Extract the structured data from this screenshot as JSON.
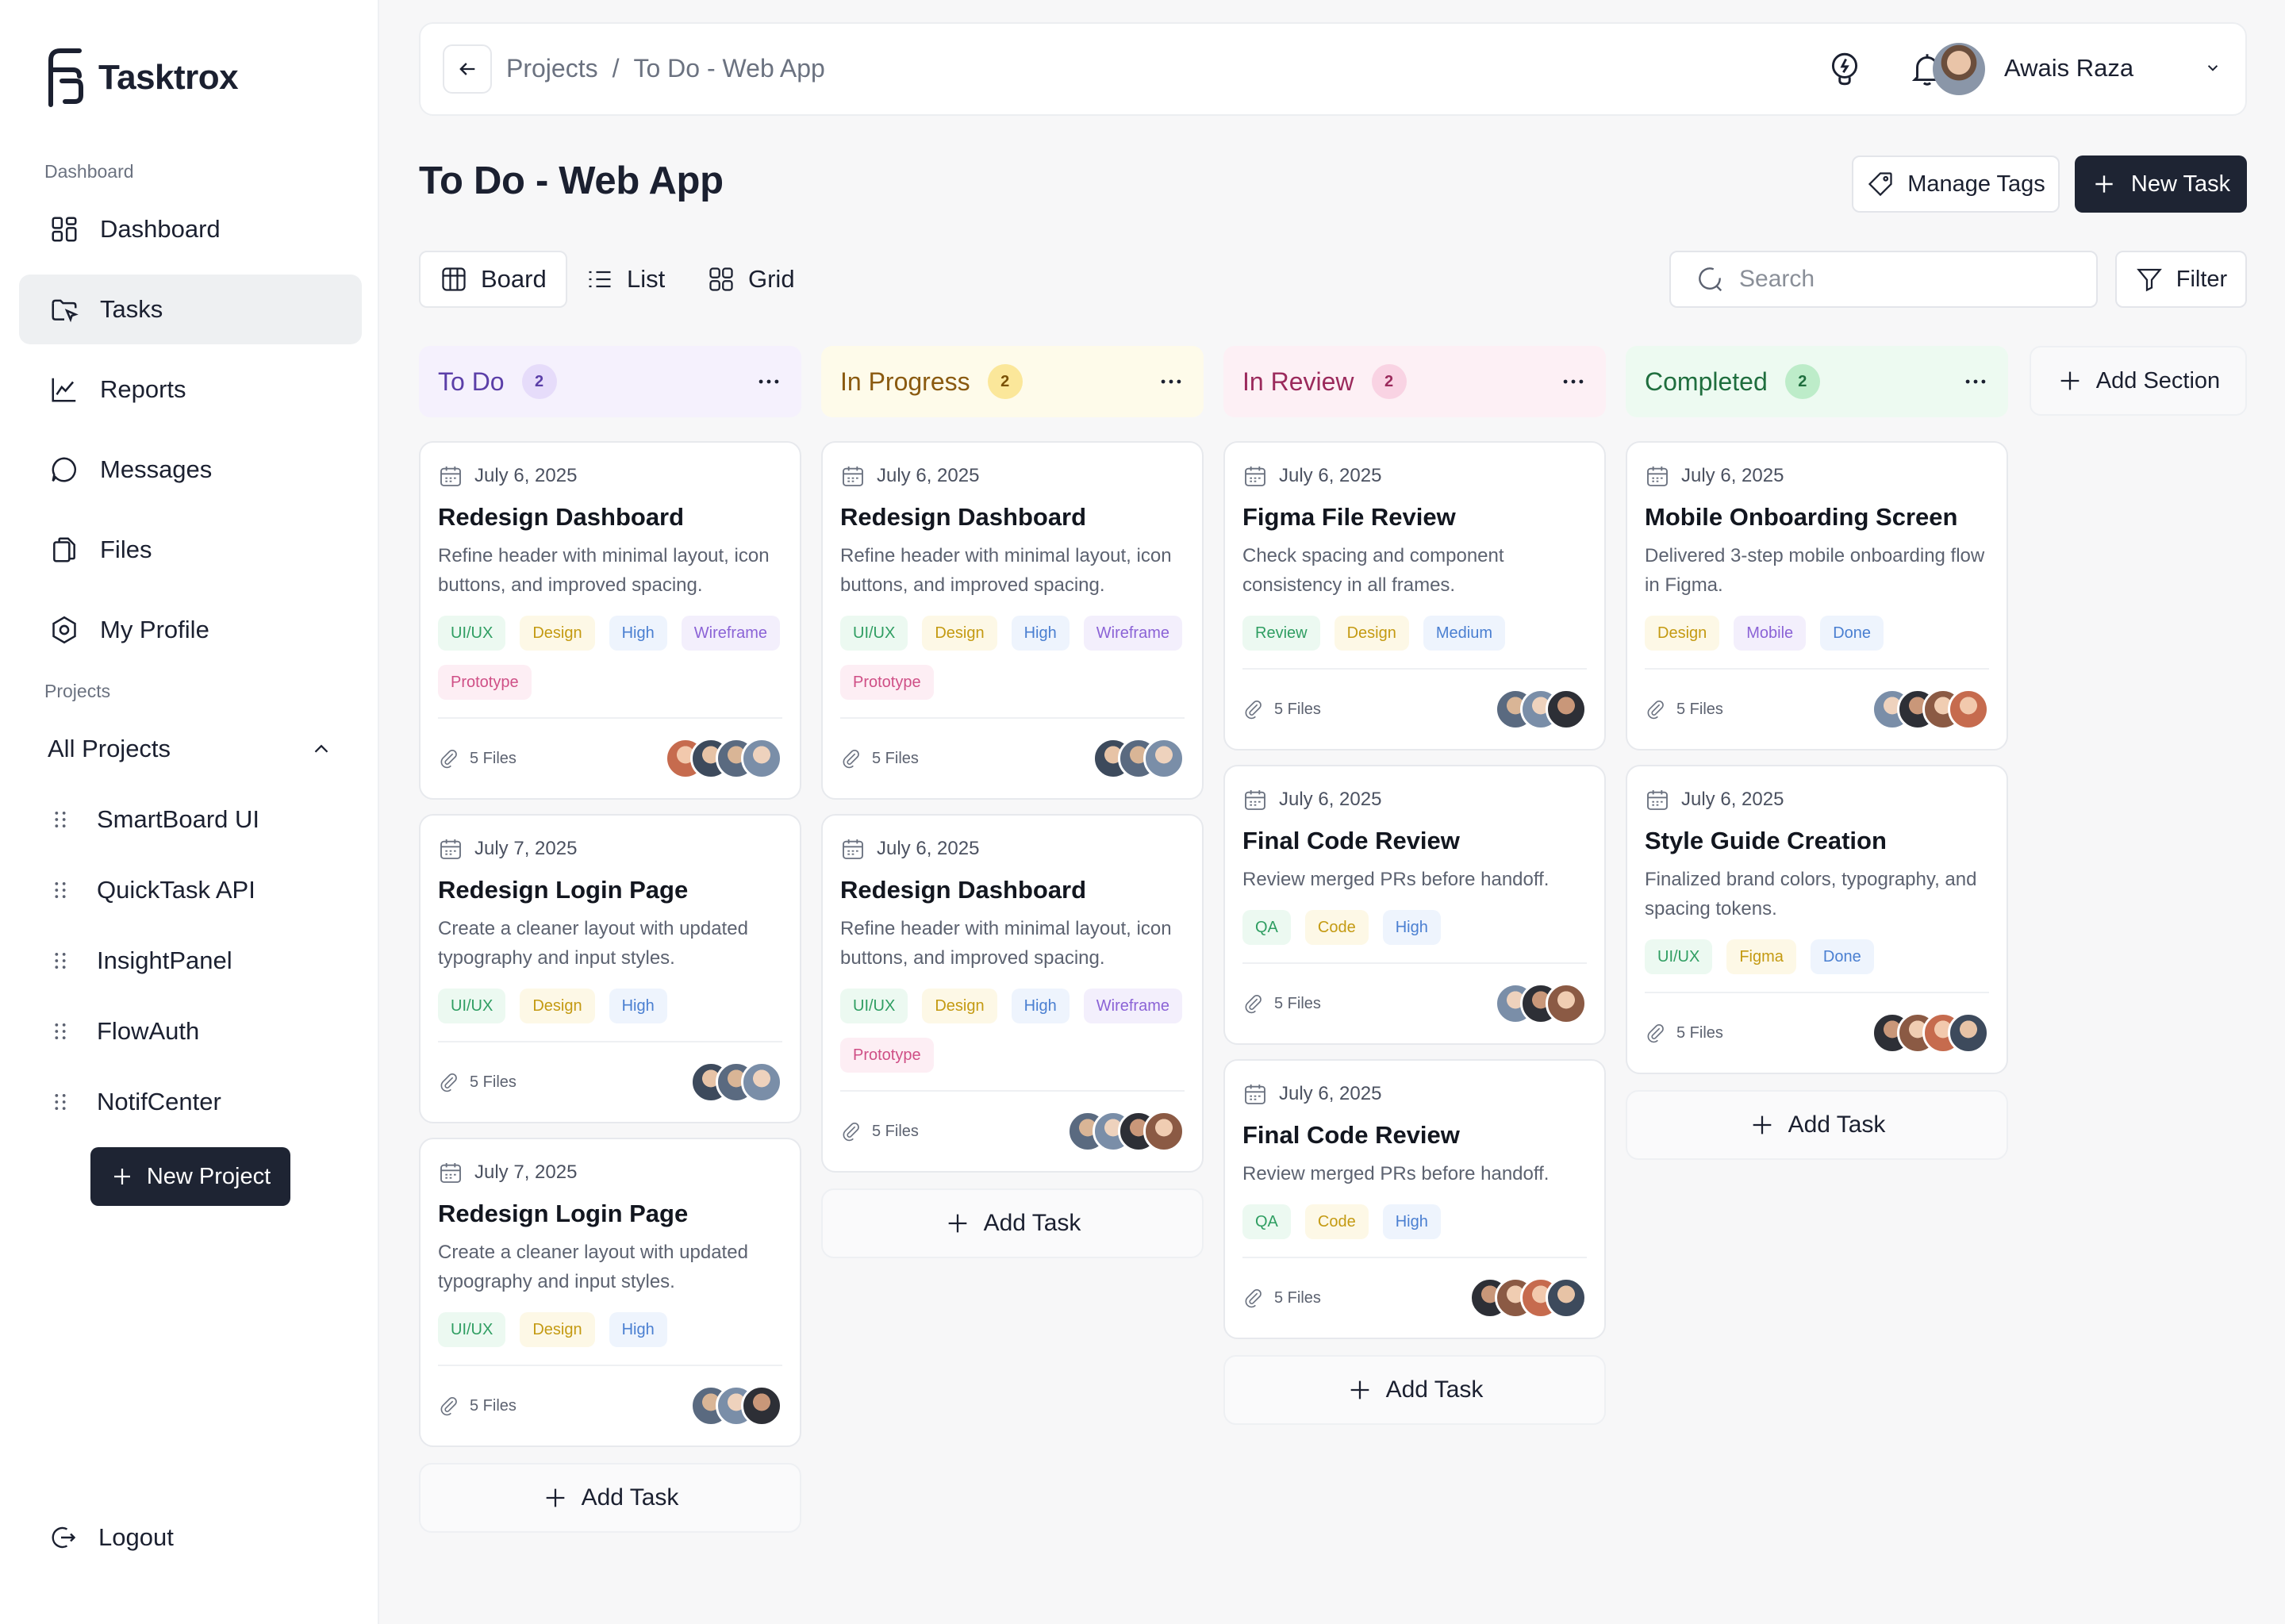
{
  "brand": {
    "name": "Tasktrox"
  },
  "sidebar": {
    "dashboard_label": "Dashboard",
    "nav": [
      {
        "label": "Dashboard",
        "icon": "grid-icon"
      },
      {
        "label": "Tasks",
        "icon": "tasks-icon"
      },
      {
        "label": "Reports",
        "icon": "chart-icon"
      },
      {
        "label": "Messages",
        "icon": "chat-icon"
      },
      {
        "label": "Files",
        "icon": "files-icon"
      },
      {
        "label": "My Profile",
        "icon": "profile-icon"
      }
    ],
    "projects_label": "Projects",
    "all_projects": "All Projects",
    "projects": [
      "SmartBoard UI",
      "QuickTask API",
      "InsightPanel",
      "FlowAuth",
      "NotifCenter"
    ],
    "new_project": "New Project",
    "logout": "Logout"
  },
  "topbar": {
    "crumb_root": "Projects",
    "crumb_sep": "/",
    "crumb_current": "To Do - Web App",
    "user_name": "Awais Raza"
  },
  "page": {
    "title": "To Do - Web App",
    "manage_tags": "Manage Tags",
    "new_task": "New Task",
    "views": [
      "Board",
      "List",
      "Grid"
    ],
    "search_placeholder": "Search",
    "filter": "Filter",
    "add_section": "Add Section",
    "add_task": "Add Task"
  },
  "tag_colors": {
    "UI/UX": [
      "#ecf9f1",
      "#2f9e62"
    ],
    "Design": [
      "#fdf8e6",
      "#c49a12"
    ],
    "High": [
      "#eef4fd",
      "#4a7fd1"
    ],
    "Wireframe": [
      "#f3effc",
      "#8b63d6"
    ],
    "Prototype": [
      "#fdeef4",
      "#cf4f86"
    ],
    "Review": [
      "#ecf9f1",
      "#2f9e62"
    ],
    "Medium": [
      "#eef4fd",
      "#4a7fd1"
    ],
    "QA": [
      "#ecf9f1",
      "#2f9e62"
    ],
    "Code": [
      "#fdf8e6",
      "#c49a12"
    ],
    "Mobile": [
      "#f3effc",
      "#8b63d6"
    ],
    "Done": [
      "#eef4fd",
      "#4a7fd1"
    ],
    "Figma": [
      "#fdf8e6",
      "#c49a12"
    ]
  },
  "columns": [
    {
      "title": "To Do",
      "count": "2",
      "bg": "#f5f1fd",
      "fg": "#5b3fa8",
      "badge_bg": "#e6dcfa",
      "badge_fg": "#5b3fa8",
      "cards": [
        {
          "date": "July 6, 2025",
          "title": "Redesign Dashboard",
          "desc": "Refine header with minimal layout, icon buttons, and improved spacing.",
          "tags": [
            "UI/UX",
            "Design",
            "High",
            "Wireframe",
            "Prototype"
          ],
          "files": "5 Files",
          "avatars": 4
        },
        {
          "date": "July 7, 2025",
          "title": "Redesign Login Page",
          "desc": "Create a cleaner layout with updated typography and input styles.",
          "tags": [
            "UI/UX",
            "Design",
            "High"
          ],
          "files": "5 Files",
          "avatars": 3
        },
        {
          "date": "July 7, 2025",
          "title": "Redesign Login Page",
          "desc": "Create a cleaner layout with updated typography and input styles.",
          "tags": [
            "UI/UX",
            "Design",
            "High"
          ],
          "files": "5 Files",
          "avatars": 3
        }
      ]
    },
    {
      "title": "In Progress",
      "count": "2",
      "bg": "#fefbea",
      "fg": "#8a5a10",
      "badge_bg": "#fbe79a",
      "badge_fg": "#7a5207",
      "cards": [
        {
          "date": "July 6, 2025",
          "title": "Redesign Dashboard",
          "desc": "Refine header with minimal layout, icon buttons, and improved spacing.",
          "tags": [
            "UI/UX",
            "Design",
            "High",
            "Wireframe",
            "Prototype"
          ],
          "files": "5 Files",
          "avatars": 3
        },
        {
          "date": "July 6, 2025",
          "title": "Redesign Dashboard",
          "desc": "Refine header with minimal layout, icon buttons, and improved spacing.",
          "tags": [
            "UI/UX",
            "Design",
            "High",
            "Wireframe",
            "Prototype"
          ],
          "files": "5 Files",
          "avatars": 4
        }
      ]
    },
    {
      "title": "In Review",
      "count": "2",
      "bg": "#fdf0f5",
      "fg": "#9b2a5c",
      "badge_bg": "#f9d3e3",
      "badge_fg": "#9b2a5c",
      "cards": [
        {
          "date": "July 6, 2025",
          "title": "Figma File Review",
          "desc": "Check spacing and component consistency in all frames.",
          "tags": [
            "Review",
            "Design",
            "Medium"
          ],
          "files": "5 Files",
          "avatars": 3
        },
        {
          "date": "July 6, 2025",
          "title": "Final Code Review",
          "desc": "Review merged PRs before handoff.",
          "tags": [
            "QA",
            "Code",
            "High"
          ],
          "files": "5 Files",
          "avatars": 3
        },
        {
          "date": "July 6, 2025",
          "title": "Final Code Review",
          "desc": "Review merged PRs before handoff.",
          "tags": [
            "QA",
            "Code",
            "High"
          ],
          "files": "5 Files",
          "avatars": 4
        }
      ]
    },
    {
      "title": "Completed",
      "count": "2",
      "bg": "#edfaf1",
      "fg": "#1f6e3e",
      "badge_bg": "#bdecc9",
      "badge_fg": "#1f6e3e",
      "cards": [
        {
          "date": "July 6, 2025",
          "title": "Mobile Onboarding Screen",
          "desc": "Delivered 3-step mobile onboarding flow in Figma.",
          "tags": [
            "Design",
            "Mobile",
            "Done"
          ],
          "files": "5 Files",
          "avatars": 4
        },
        {
          "date": "July 6, 2025",
          "title": "Style Guide Creation",
          "desc": "Finalized brand colors, typography, and spacing tokens.",
          "tags": [
            "UI/UX",
            "Figma",
            "Done"
          ],
          "files": "5 Files",
          "avatars": 4
        }
      ]
    }
  ]
}
